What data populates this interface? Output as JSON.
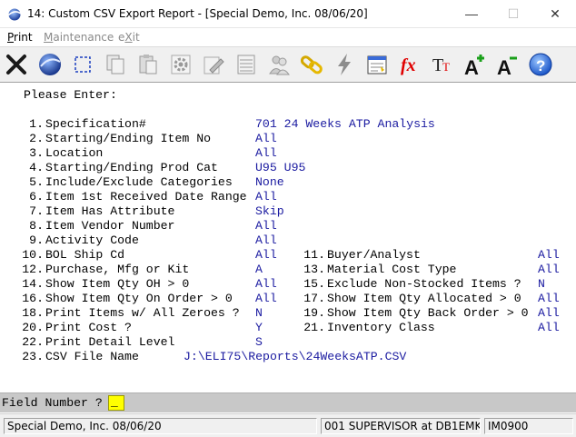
{
  "window": {
    "title": "14: Custom CSV Export Report - [Special Demo, Inc. 08/06/20]",
    "minimize": "—",
    "maximize": "☐",
    "close": "✕"
  },
  "menu": {
    "print": "Print",
    "maintenance": "Maintenance",
    "exit": "eXit"
  },
  "toolbar": {
    "buttons": [
      "close-x-icon",
      "globe-icon",
      "select-area-icon",
      "copy-icon",
      "paste-icon",
      "settings-gear-icon",
      "edit-icon",
      "list-view-icon",
      "users-icon",
      "link-chain-icon",
      "lightning-icon",
      "calendar-icon",
      "function-fx-icon",
      "font-size-icon",
      "font-increase-icon",
      "font-decrease-icon",
      "help-icon"
    ]
  },
  "form": {
    "header": "Please Enter:",
    "rows_left": [
      {
        "num": "1.",
        "label": "Specification#",
        "value": "701 24 Weeks ATP Analysis"
      },
      {
        "num": "2.",
        "label": "Starting/Ending Item No",
        "value": "All"
      },
      {
        "num": "3.",
        "label": "Location",
        "value": "All"
      },
      {
        "num": "4.",
        "label": "Starting/Ending Prod Cat",
        "value": "U95 U95"
      },
      {
        "num": "5.",
        "label": "Include/Exclude Categories",
        "value": "None"
      },
      {
        "num": "6.",
        "label": "Item 1st Received Date Range",
        "value": "All"
      },
      {
        "num": "7.",
        "label": "Item Has Attribute",
        "value": "Skip"
      },
      {
        "num": "8.",
        "label": "Item Vendor Number",
        "value": "All"
      },
      {
        "num": "9.",
        "label": "Activity Code",
        "value": "All"
      },
      {
        "num": "10.",
        "label": "BOL Ship Cd",
        "value": "All"
      },
      {
        "num": "12.",
        "label": "Purchase, Mfg or Kit",
        "value": "A"
      },
      {
        "num": "14.",
        "label": "Show Item Qty OH > 0",
        "value": "All"
      },
      {
        "num": "16.",
        "label": "Show Item Qty On Order > 0",
        "value": "All"
      },
      {
        "num": "18.",
        "label": "Print Items w/ All Zeroes ?",
        "value": "N"
      },
      {
        "num": "20.",
        "label": "Print Cost ?",
        "value": "Y"
      },
      {
        "num": "22.",
        "label": "Print Detail Level",
        "value": "S"
      }
    ],
    "rows_right": [
      {
        "num": "11.",
        "label": "Buyer/Analyst",
        "value": "All"
      },
      {
        "num": "13.",
        "label": "Material Cost Type",
        "value": "All"
      },
      {
        "num": "15.",
        "label": "Exclude Non-Stocked Items ?",
        "value": "N"
      },
      {
        "num": "17.",
        "label": "Show Item Qty Allocated > 0",
        "value": "All"
      },
      {
        "num": "19.",
        "label": "Show Item Qty Back Order > 0",
        "value": "All"
      },
      {
        "num": "21.",
        "label": "Inventory Class",
        "value": "All"
      }
    ],
    "csv_row": {
      "num": "23.",
      "label": "CSV File Name",
      "value": "J:\\ELI75\\Reports\\24WeeksATP.CSV"
    }
  },
  "prompt": {
    "label": "Field Number ?",
    "value": "_"
  },
  "status": {
    "company": "Special Demo, Inc. 08/06/20",
    "user": "001 SUPERVISOR at DB1EMK",
    "program": "IM0900"
  },
  "colors": {
    "value_blue": "#1a1aa0",
    "prompt_input": "#ffff00",
    "prompt_bar": "#c8c8c8"
  }
}
